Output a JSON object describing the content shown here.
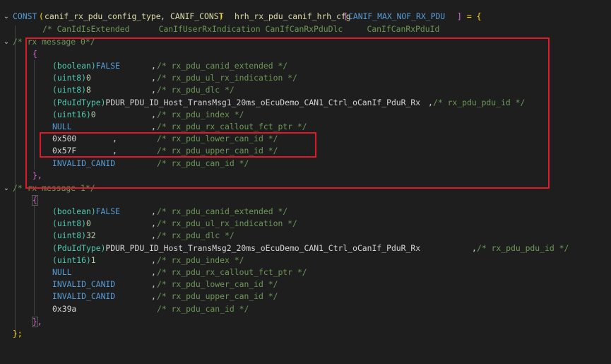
{
  "editor": {
    "declaration": {
      "kw_const": "CONST",
      "open_paren": "(",
      "type": "canif_rx_pdu_config_type",
      "comma": ",",
      "const_macro": "CANIF_CONST",
      "close_paren": ")",
      "name": "hrh_rx_pdu_canif_hrh_cfg",
      "open_bracket": "[",
      "size_macro": "CANIF_MAX_NOF_RX_PDU",
      "close_bracket": "]",
      "assign": " = {"
    },
    "header_comment": "/* CanIdIsExtended      CanIfUserRxIndication CanIfCanRxPduDlc     CanIfCanRxPduId",
    "message0": {
      "comment": "/* rx message 0*/",
      "open": "{",
      "rows": [
        {
          "cast": "(boolean)",
          "value": "FALSE",
          "sep": ",",
          "comment": "/* rx_pdu_canid_extended */"
        },
        {
          "cast": "(uint8)",
          "value": "0",
          "sep": ",",
          "comment": "/* rx_pdu_ul_rx_indication */"
        },
        {
          "cast": "(uint8)",
          "value": "8",
          "sep": ",",
          "comment": "/* rx_pdu_dlc */"
        },
        {
          "cast": "(PduIdType)",
          "value": "PDUR_PDU_ID_Host_TransMsg1_20ms_oEcuDemo_CAN1_Ctrl_oCanIf_PduR_Rx",
          "sep": ",",
          "comment": "/* rx_pdu_pdu_id */"
        },
        {
          "cast": "(uint16)",
          "value": "0",
          "sep": ",",
          "comment": "/* rx_pdu_index */"
        },
        {
          "cast": "",
          "value": "NULL",
          "sep": ",",
          "comment": "/* rx_pdu_rx_callout_fct_ptr */"
        },
        {
          "cast": "",
          "value": "0x500",
          "sep": ",",
          "comment": "/* rx_pdu_lower_can_id */"
        },
        {
          "cast": "",
          "value": "0x57F",
          "sep": ",",
          "comment": "/* rx_pdu_upper_can_id */"
        },
        {
          "cast": "",
          "value": "INVALID_CANID",
          "sep": "",
          "comment": "/* rx_pdu_can_id */"
        }
      ],
      "close": "},"
    },
    "message1": {
      "comment": "/* rx message 1*/",
      "open": "{",
      "rows": [
        {
          "cast": "(boolean)",
          "value": "FALSE",
          "sep": ",",
          "comment": "/* rx_pdu_canid_extended */"
        },
        {
          "cast": "(uint8)",
          "value": "0",
          "sep": ",",
          "comment": "/* rx_pdu_ul_rx_indication */"
        },
        {
          "cast": "(uint8)",
          "value": "32",
          "sep": ",",
          "comment": "/* rx_pdu_dlc */"
        },
        {
          "cast": "(PduIdType)",
          "value": "PDUR_PDU_ID_Host_TransMsg2_20ms_oEcuDemo_CAN1_Ctrl_oCanIf_PduR_Rx",
          "sep": ",",
          "comment": "/* rx_pdu_pdu_id */"
        },
        {
          "cast": "(uint16)",
          "value": "1",
          "sep": ",",
          "comment": "/* rx_pdu_index */"
        },
        {
          "cast": "",
          "value": "NULL",
          "sep": ",",
          "comment": "/* rx_pdu_rx_callout_fct_ptr */"
        },
        {
          "cast": "",
          "value": "INVALID_CANID",
          "sep": ",",
          "comment": "/* rx_pdu_lower_can_id */"
        },
        {
          "cast": "",
          "value": "INVALID_CANID",
          "sep": ",",
          "comment": "/* rx_pdu_upper_can_id */"
        },
        {
          "cast": "",
          "value": "0x39a",
          "sep": "",
          "comment": "/* rx_pdu_can_id */"
        }
      ],
      "close": "},"
    },
    "closing": "};",
    "fold_icons": {
      "expanded": "chevron-down-icon"
    },
    "colors": {
      "background": "#1e1e1e",
      "highlight_box": "#e0192b",
      "comment": "#6a9955",
      "keyword": "#569cd6",
      "type": "#4ec9b0"
    }
  }
}
